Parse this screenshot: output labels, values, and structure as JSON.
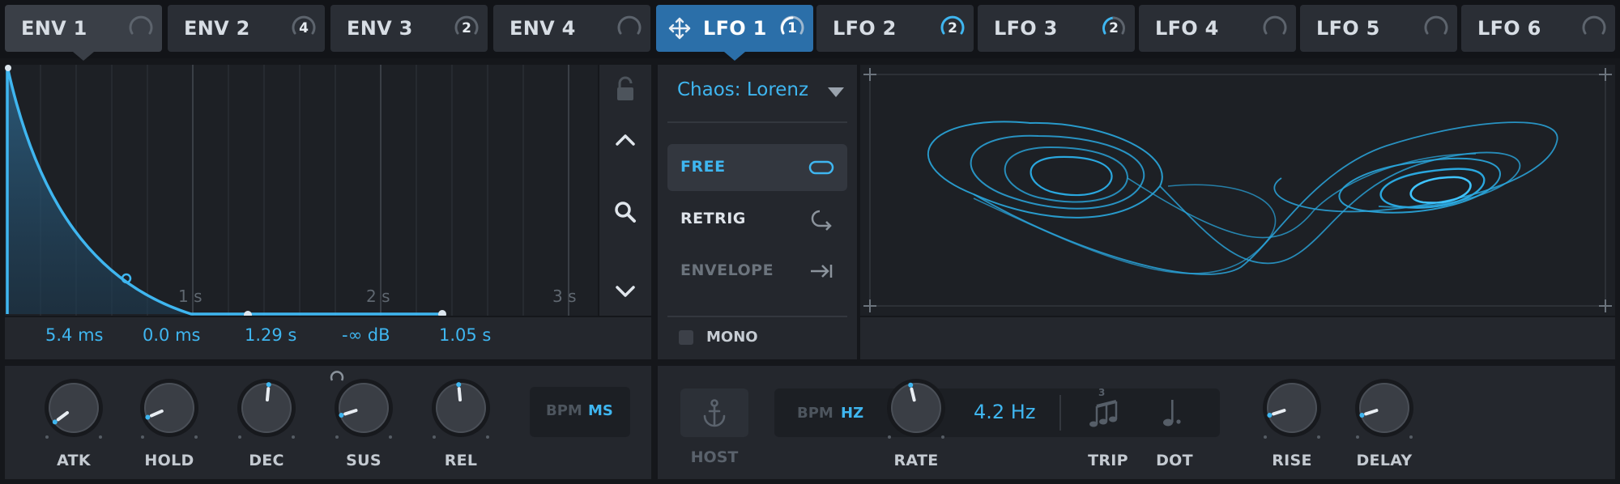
{
  "colors": {
    "accent": "#3fb6f0",
    "active_tab": "#2b6fa9",
    "panel": "#24272d",
    "graph_bg": "#1d2025"
  },
  "tabs": [
    {
      "label": "ENV 1",
      "badge": ""
    },
    {
      "label": "ENV 2",
      "badge": "4"
    },
    {
      "label": "ENV 3",
      "badge": "2"
    },
    {
      "label": "ENV 4",
      "badge": ""
    },
    {
      "label": "LFO 1",
      "badge": "1"
    },
    {
      "label": "LFO 2",
      "badge": "2"
    },
    {
      "label": "LFO 3",
      "badge": "2"
    },
    {
      "label": "LFO 4",
      "badge": ""
    },
    {
      "label": "LFO 5",
      "badge": ""
    },
    {
      "label": "LFO 6",
      "badge": ""
    }
  ],
  "envelope": {
    "time_markers": [
      "1 s",
      "2 s",
      "3 s"
    ],
    "values": {
      "attack": "5.4 ms",
      "hold": "0.0 ms",
      "decay": "1.29 s",
      "sustain": "-∞ dB",
      "release": "1.05 s"
    },
    "knobs": {
      "attack": {
        "label": "ATK",
        "position": 0.03
      },
      "hold": {
        "label": "HOLD",
        "position": 0.08
      },
      "decay": {
        "label": "DEC",
        "position": 0.52
      },
      "sustain": {
        "label": "SUS",
        "position": 0.1
      },
      "release": {
        "label": "REL",
        "position": 0.48
      }
    },
    "time_mode": {
      "a": "BPM",
      "b": "MS"
    },
    "side_icons": [
      "lock-icon",
      "chevron-up-icon",
      "zoom-icon",
      "chevron-down-icon"
    ]
  },
  "lfo": {
    "shape": "Chaos: Lorenz",
    "modes": [
      {
        "label": "FREE",
        "active": true
      },
      {
        "label": "RETRIG",
        "active": false
      },
      {
        "label": "ENVELOPE",
        "active": false
      }
    ],
    "mono_label": "MONO",
    "host_label": "HOST",
    "rate_mode": {
      "a": "BPM",
      "b": "HZ"
    },
    "rate_value": "4.2 Hz",
    "knobs": {
      "rate": {
        "label": "RATE",
        "position": 0.45
      },
      "rise": {
        "label": "RISE",
        "position": 0.1
      },
      "delay": {
        "label": "DELAY",
        "position": 0.1
      }
    },
    "trip_label": "TRIP",
    "dot_label": "DOT",
    "trip_number": "3"
  }
}
